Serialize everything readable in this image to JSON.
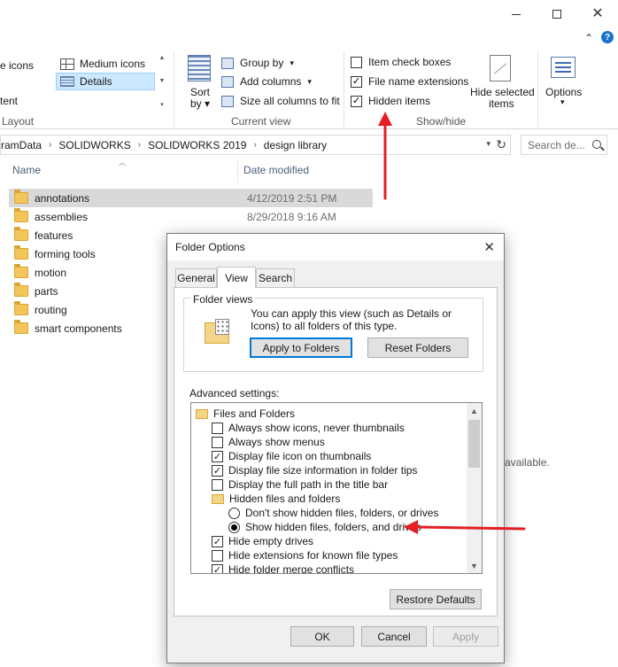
{
  "window": {
    "minimize_icon": "minimize-icon",
    "maximize_icon": "maximize-icon",
    "close_icon": "close-icon"
  },
  "ribbon": {
    "layout": {
      "large_icons_partial": "e icons",
      "medium_icons": "Medium icons",
      "content_partial": "tent",
      "details": "Details",
      "group_label": "Layout"
    },
    "current_view": {
      "sort_by": "Sort",
      "sort_by_2": "by",
      "group_by": "Group by",
      "add_columns": "Add columns",
      "size_all_columns": "Size all columns to fit",
      "group_label": "Current view"
    },
    "show_hide": {
      "item_check_boxes": "Item check boxes",
      "file_name_extensions": "File name extensions",
      "hidden_items": "Hidden items",
      "hide_selected_items_1": "Hide selected",
      "hide_selected_items_2": "items",
      "group_label": "Show/hide",
      "checks": {
        "item_check_boxes": false,
        "file_name_extensions": true,
        "hidden_items": true
      }
    },
    "options": {
      "label": "Options"
    }
  },
  "address": {
    "crumbs": [
      "ramData",
      "SOLIDWORKS",
      "SOLIDWORKS 2019",
      "design library"
    ],
    "search_placeholder": "Search de..."
  },
  "filelist": {
    "col_name": "Name",
    "col_date": "Date modified",
    "rows": [
      {
        "name": "annotations",
        "date": "4/12/2019 2:51 PM"
      },
      {
        "name": "assemblies",
        "date": "8/29/2018 9:16 AM"
      },
      {
        "name": "features",
        "date": ""
      },
      {
        "name": "forming tools",
        "date": ""
      },
      {
        "name": "motion",
        "date": ""
      },
      {
        "name": "parts",
        "date": ""
      },
      {
        "name": "routing",
        "date": ""
      },
      {
        "name": "smart components",
        "date": ""
      }
    ],
    "preview_partial": "available."
  },
  "dialog": {
    "title": "Folder Options",
    "tabs": [
      "General",
      "View",
      "Search"
    ],
    "folder_views": {
      "legend": "Folder views",
      "description": "You can apply this view (such as Details or Icons) to all folders of this type.",
      "apply_button": "Apply to Folders",
      "reset_button": "Reset Folders"
    },
    "advanced_label": "Advanced settings:",
    "tree": [
      {
        "type": "folder",
        "label": "Files and Folders",
        "indent": 0
      },
      {
        "type": "check",
        "label": "Always show icons, never thumbnails",
        "checked": false,
        "indent": 1
      },
      {
        "type": "check",
        "label": "Always show menus",
        "checked": false,
        "indent": 1
      },
      {
        "type": "check",
        "label": "Display file icon on thumbnails",
        "checked": true,
        "indent": 1
      },
      {
        "type": "check",
        "label": "Display file size information in folder tips",
        "checked": true,
        "indent": 1
      },
      {
        "type": "check",
        "label": "Display the full path in the title bar",
        "checked": false,
        "indent": 1
      },
      {
        "type": "folder",
        "label": "Hidden files and folders",
        "indent": 1
      },
      {
        "type": "radio",
        "label": "Don't show hidden files, folders, or drives",
        "checked": false,
        "indent": 2
      },
      {
        "type": "radio",
        "label": "Show hidden files, folders, and drives",
        "checked": true,
        "indent": 2
      },
      {
        "type": "check",
        "label": "Hide empty drives",
        "checked": true,
        "indent": 1
      },
      {
        "type": "check",
        "label": "Hide extensions for known file types",
        "checked": false,
        "indent": 1
      },
      {
        "type": "check",
        "label": "Hide folder merge conflicts",
        "checked": true,
        "indent": 1
      }
    ],
    "restore_defaults": "Restore Defaults",
    "ok": "OK",
    "cancel": "Cancel",
    "apply": "Apply"
  },
  "annotation_color": "#e31e24"
}
